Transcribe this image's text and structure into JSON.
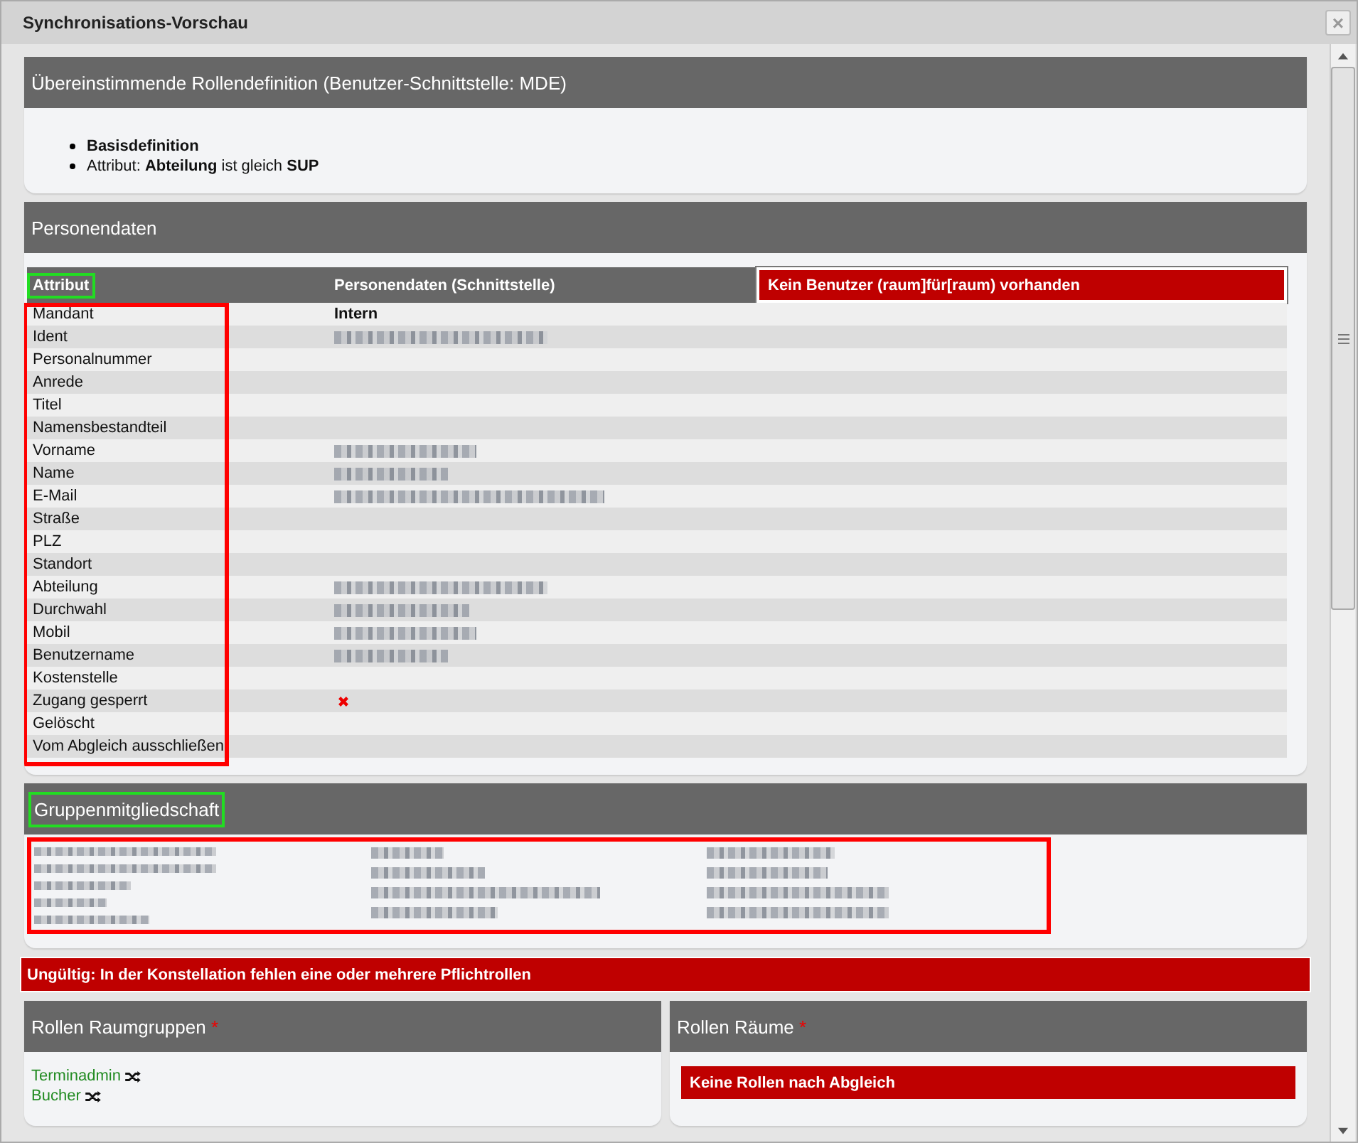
{
  "dialog": {
    "title": "Synchronisations-Vorschau",
    "close": "×"
  },
  "role_definition": {
    "title": "Übereinstimmende Rollendefinition (Benutzer-Schnittstelle: MDE)",
    "items": [
      "**Basisdefinition**",
      "Attribut: **Abteilung** ist gleich **SUP**"
    ]
  },
  "person_data": {
    "title": "Personendaten",
    "columns": [
      {
        "label": "Attribut",
        "kind": "header",
        "annotation": {
          "color": "#22dd22"
        }
      },
      {
        "label": "Personendaten (Schnittstelle)",
        "kind": "header"
      },
      {
        "label": "Kein Benutzer (raum]für[raum) vorhanden",
        "kind": "error"
      }
    ],
    "attributes_annotation": {
      "color": "#ff0000"
    },
    "rows": [
      {
        "attribute": "Mandant",
        "kind": "text",
        "value": "Intern"
      },
      {
        "attribute": "Ident",
        "kind": "blurred"
      },
      {
        "attribute": "Personalnummer",
        "kind": "empty"
      },
      {
        "attribute": "Anrede",
        "kind": "empty"
      },
      {
        "attribute": "Titel",
        "kind": "empty"
      },
      {
        "attribute": "Namensbestandteil",
        "kind": "empty"
      },
      {
        "attribute": "Vorname",
        "kind": "blurred"
      },
      {
        "attribute": "Name",
        "kind": "blurred"
      },
      {
        "attribute": "E-Mail",
        "kind": "blurred"
      },
      {
        "attribute": "Straße",
        "kind": "empty"
      },
      {
        "attribute": "PLZ",
        "kind": "empty"
      },
      {
        "attribute": "Standort",
        "kind": "empty"
      },
      {
        "attribute": "Abteilung",
        "kind": "blurred"
      },
      {
        "attribute": "Durchwahl",
        "kind": "blurred"
      },
      {
        "attribute": "Mobil",
        "kind": "blurred"
      },
      {
        "attribute": "Benutzername",
        "kind": "blurred"
      },
      {
        "attribute": "Kostenstelle",
        "kind": "empty"
      },
      {
        "attribute": "Zugang gesperrt",
        "kind": "cross"
      },
      {
        "attribute": "Gelöscht",
        "kind": "empty"
      },
      {
        "attribute": "Vom Abgleich ausschließen",
        "kind": "empty"
      }
    ]
  },
  "group_membership": {
    "title": "Gruppenmitgliedschaft",
    "title_annotation": {
      "color": "#22dd22"
    },
    "groups_annotation": {
      "color": "#ff0000"
    },
    "columns": [
      {
        "items": [
          {
            "kind": "blurred"
          },
          {
            "kind": "blurred"
          },
          {
            "kind": "blurred"
          },
          {
            "kind": "blurred"
          },
          {
            "kind": "blurred"
          }
        ]
      },
      {
        "items": [
          {
            "kind": "blurred"
          },
          {
            "kind": "blurred"
          },
          {
            "kind": "blurred"
          },
          {
            "kind": "blurred"
          }
        ]
      },
      {
        "items": [
          {
            "kind": "blurred"
          },
          {
            "kind": "blurred"
          },
          {
            "kind": "blurred"
          },
          {
            "kind": "blurred"
          }
        ]
      }
    ]
  },
  "error": "Ungültig: In der Konstellation fehlen eine oder mehrere Pflichtrollen",
  "role_panels": [
    {
      "title": "Rollen Raumgruppen",
      "required": "*",
      "roles": [
        "Terminadmin",
        "Bucher"
      ]
    },
    {
      "title": "Rollen Räume",
      "required": "*",
      "message": "Keine Rollen nach Abgleich"
    }
  ]
}
